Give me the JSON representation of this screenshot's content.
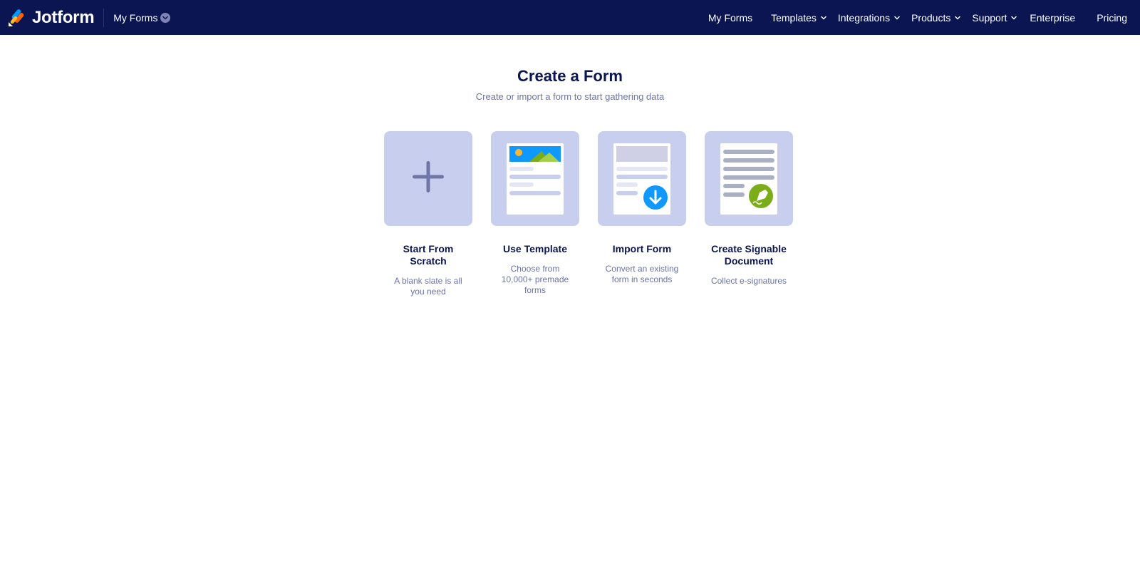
{
  "header": {
    "brand": "Jotform",
    "my_forms_dropdown": "My Forms",
    "nav": [
      {
        "label": "My Forms",
        "has_chevron": false
      },
      {
        "label": "Templates",
        "has_chevron": true
      },
      {
        "label": "Integrations",
        "has_chevron": true
      },
      {
        "label": "Products",
        "has_chevron": true
      },
      {
        "label": "Support",
        "has_chevron": true
      },
      {
        "label": "Enterprise",
        "has_chevron": false
      },
      {
        "label": "Pricing",
        "has_chevron": false
      }
    ]
  },
  "main": {
    "title": "Create a Form",
    "subtitle": "Create or import a form to start gathering data",
    "options": [
      {
        "title": "Start From Scratch",
        "description": "A blank slate is all you need",
        "icon": "plus-icon"
      },
      {
        "title": "Use Template",
        "description": "Choose from 10,000+ premade forms",
        "icon": "template-icon"
      },
      {
        "title": "Import Form",
        "description": "Convert an existing form in seconds",
        "icon": "import-icon"
      },
      {
        "title": "Create Signable Document",
        "description": "Collect e-signatures",
        "icon": "signature-icon"
      }
    ]
  },
  "colors": {
    "header_bg": "#0a1551",
    "tile_bg": "#c8ceed",
    "title_text": "#0a1551",
    "muted_text": "#6c73a8",
    "import_accent": "#0f99ff",
    "sign_accent": "#7aad17"
  }
}
